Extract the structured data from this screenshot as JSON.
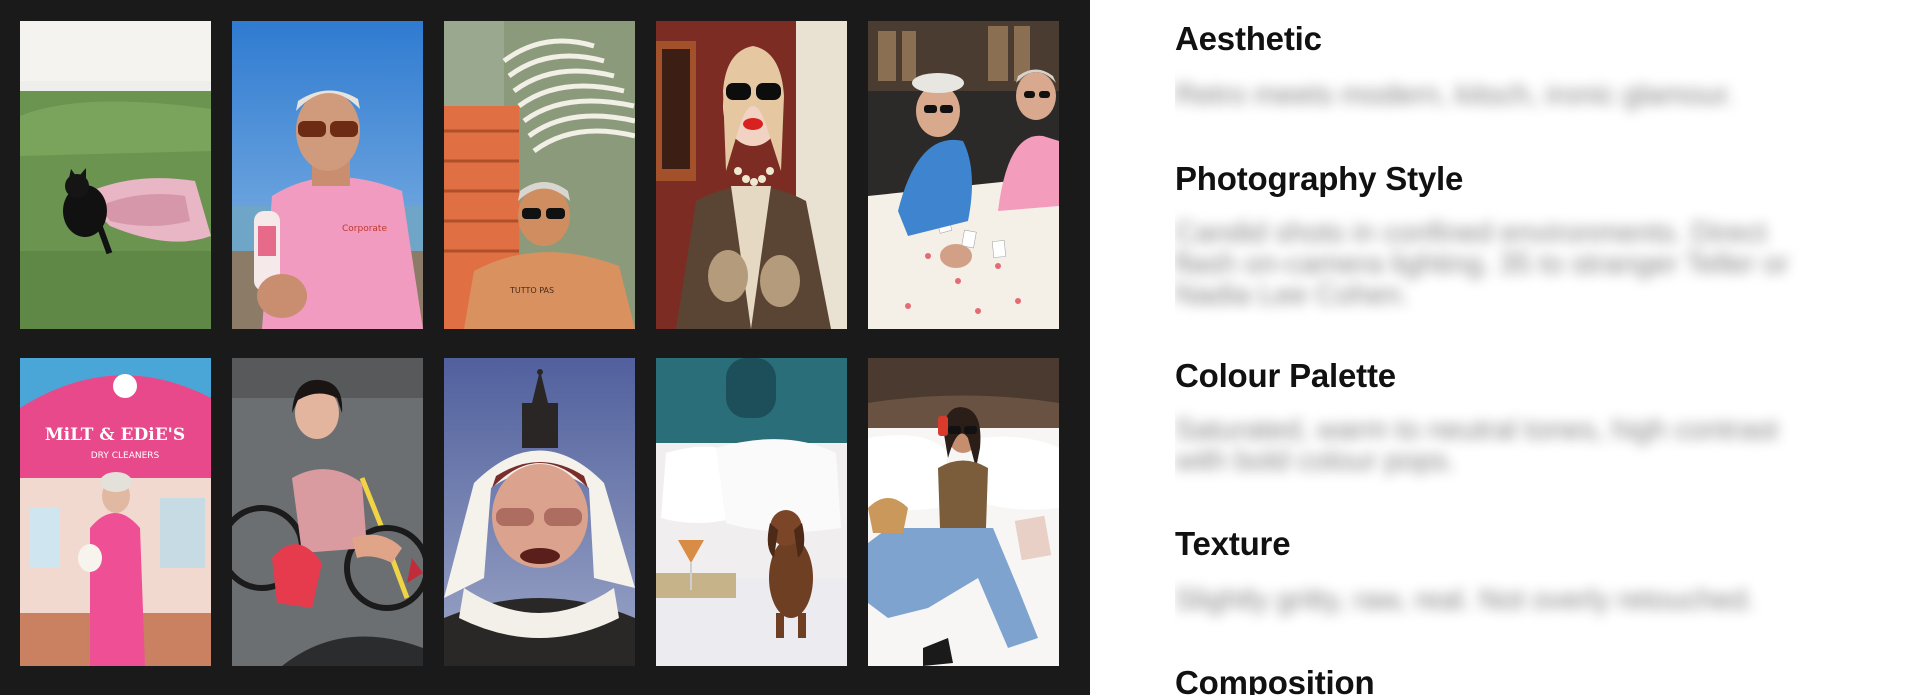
{
  "gallery": {
    "tiles": [
      {
        "subject": "cat-on-green-sofa"
      },
      {
        "subject": "man-in-pink-tee-with-milk-bottle"
      },
      {
        "subject": "man-sunbathing-by-stacked-chairs"
      },
      {
        "subject": "woman-in-sunglasses-and-pearls"
      },
      {
        "subject": "women-playing-cards"
      },
      {
        "subject": "woman-in-pink-suit-by-shopfront",
        "sign_line_1": "MiLT & EDiE'S",
        "sign_line_2": "DRY CLEANERS"
      },
      {
        "subject": "woman-on-bicycle"
      },
      {
        "subject": "woman-in-headscarf-and-church-spire"
      },
      {
        "subject": "dachshund-on-hotel-bed"
      },
      {
        "subject": "woman-on-bed-with-phone"
      }
    ]
  },
  "sections": [
    {
      "title": "Aesthetic",
      "text": "Retro meets modern, kitsch, ironic glamour."
    },
    {
      "title": "Photography Style",
      "text": "Candid shots in confined environments. Direct flash on-camera lighting. 35 to stranger Teller or Nadia Lee Cohen."
    },
    {
      "title": "Colour Palette",
      "text": "Saturated, warm to neutral tones, high contrast with bold colour pops."
    },
    {
      "title": "Texture",
      "text": "Slightly gritty, raw, real. Not overly retouched."
    },
    {
      "title": "Composition",
      "text": ""
    }
  ]
}
